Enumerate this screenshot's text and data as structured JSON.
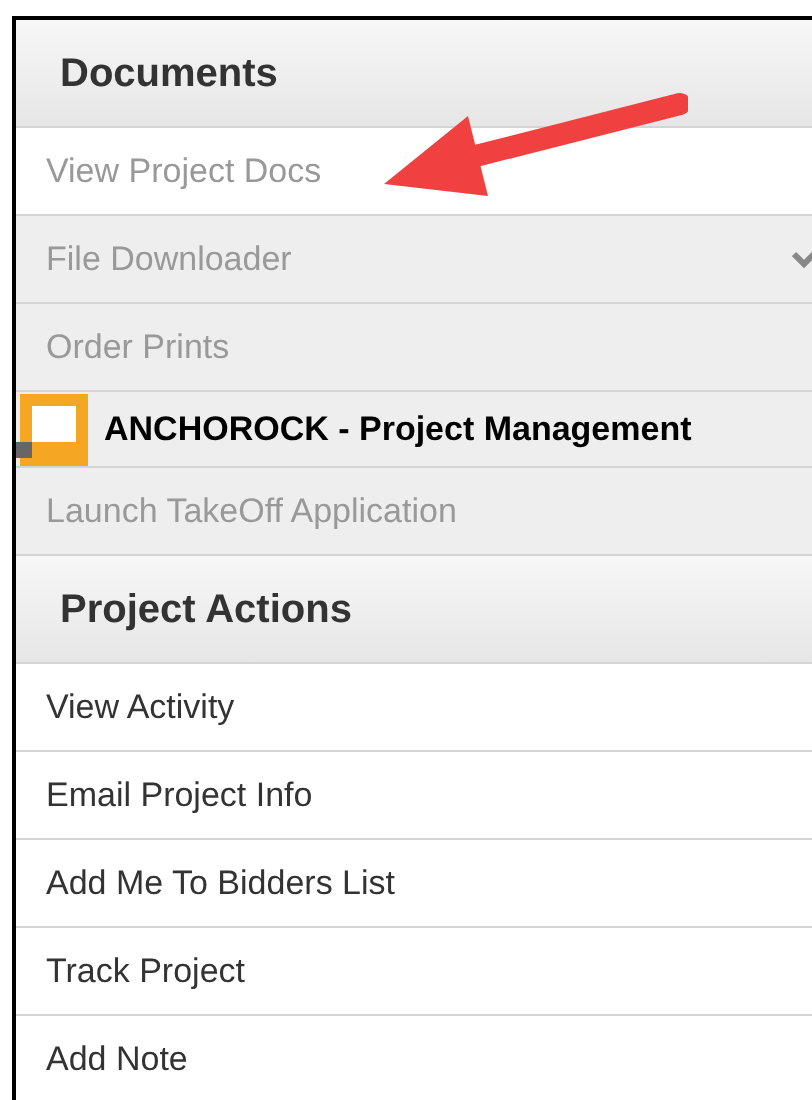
{
  "sections": [
    {
      "title": "Documents",
      "items": [
        {
          "kind": "link",
          "label": "View Project Docs",
          "selected": true
        },
        {
          "kind": "dropdown",
          "label": "File Downloader",
          "selected": false
        },
        {
          "kind": "link",
          "label": "Order Prints",
          "selected": false
        },
        {
          "kind": "brand",
          "label": "ANCHOROCK - Project Management",
          "selected": false
        },
        {
          "kind": "link",
          "label": "Launch TakeOff Application",
          "selected": false
        }
      ]
    },
    {
      "title": "Project Actions",
      "items": [
        {
          "kind": "action",
          "label": "View Activity"
        },
        {
          "kind": "action",
          "label": "Email Project Info"
        },
        {
          "kind": "action",
          "label": "Add Me To Bidders List"
        },
        {
          "kind": "action",
          "label": "Track Project"
        },
        {
          "kind": "action",
          "label": "Add Note"
        }
      ]
    }
  ]
}
